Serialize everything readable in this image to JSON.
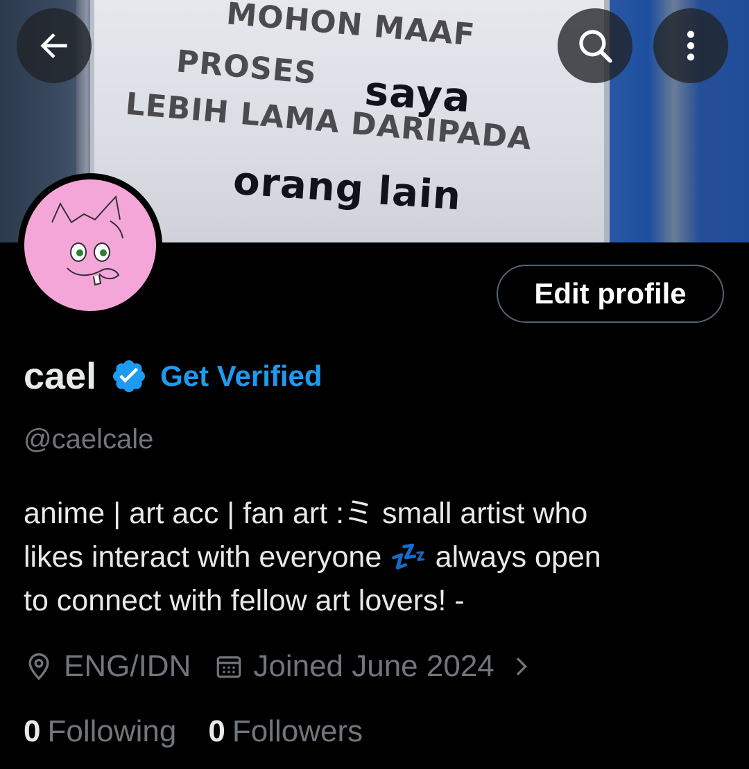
{
  "banner": {
    "sign_line_1": "MOHON MAAF",
    "sign_line_2": "PROSES",
    "sign_hand_1": "saya",
    "sign_line_3": "LEBIH LAMA DARIPADA",
    "sign_hand_2": "orang lain"
  },
  "header": {
    "back_icon": "arrow-left-icon",
    "search_icon": "search-icon",
    "more_icon": "more-vertical-icon"
  },
  "profile": {
    "edit_label": "Edit profile",
    "display_name": "cael",
    "get_verified_label": "Get Verified",
    "handle": "@caelcale",
    "bio_lines": [
      "anime | art acc | fan art :ミ small artist who",
      "likes interact with everyone 💤  always open",
      "to connect with fellow art lovers! -"
    ],
    "location": "ENG/IDN",
    "joined": "Joined June 2024",
    "following_count": "0",
    "following_label": "Following",
    "followers_count": "0",
    "followers_label": "Followers"
  },
  "colors": {
    "accent": "#1d9bf0",
    "secondary_text": "#71767b",
    "avatar_bg": "#f4a6d8"
  }
}
